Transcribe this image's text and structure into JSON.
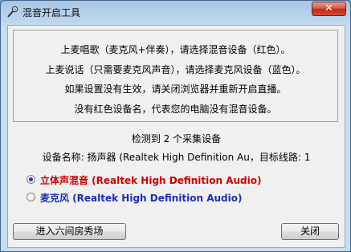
{
  "window": {
    "title": "混音开启工具",
    "close_symbol": "✕"
  },
  "info": {
    "lines": [
      "上麦唱歌（麦克风+伴奏），请选择混音设备（红色）。",
      "上麦说话（只需要麦克风声音），请选择麦克风设备（蓝色）。",
      "如果设置没有生效，请关闭浏览器并重新开启直播。",
      "没有红色设备名，代表您的电脑没有混音设备。"
    ]
  },
  "status": {
    "detected": "检测到 2 个采集设备",
    "device_name": "设备名称: 扬声器 (Realtek High Definition Au，目标线路: 1"
  },
  "devices": [
    {
      "label": "立体声混音 (Realtek High Definition Audio)",
      "color": "#cc0000",
      "selected": true
    },
    {
      "label": "麦克风 (Realtek High Definition Audio)",
      "color": "#1a2fb0",
      "selected": false
    }
  ],
  "buttons": {
    "enter_room": "进入六间房秀场",
    "close": "关闭"
  },
  "icons": {
    "app": "mic-icon",
    "close": "close-icon"
  }
}
